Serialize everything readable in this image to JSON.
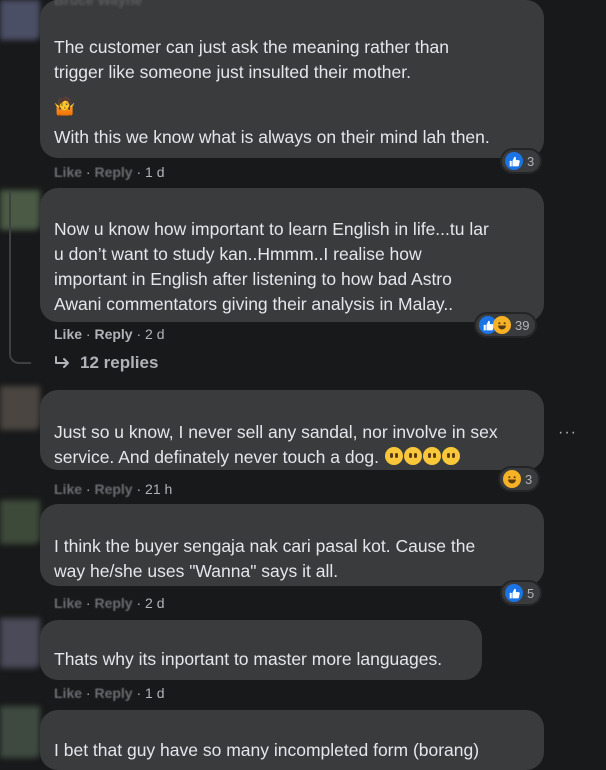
{
  "comments": [
    {
      "author": "Bruce Wayne",
      "lines": [
        "The customer can just ask the meaning rather than",
        "trigger like someone just insulted their mother."
      ],
      "emoji_line": "🤷",
      "lines2": [
        "With this we know what is always on their mind lah then."
      ],
      "actions": {
        "like": "Like",
        "reply": "Reply",
        "time": "1 d"
      },
      "reactions": {
        "count": "3"
      }
    },
    {
      "lines": [
        "Now u know how important to learn English in life...tu lar",
        "u don’t want to study kan..Hmmm..I realise how",
        "important in English after listening to how bad Astro",
        "Awani commentators giving their analysis in Malay.."
      ],
      "actions": {
        "like": "Like",
        "reply": "Reply",
        "time": "2 d"
      },
      "reactions": {
        "count": "39"
      }
    },
    {
      "lines": [
        "Just so u know, I never sell any sandal, nor involve in sex",
        "service. And definately never touch a dog."
      ],
      "actions": {
        "like": "Like",
        "reply": "Reply",
        "time": "21 h"
      },
      "reactions": {
        "count": "3"
      }
    },
    {
      "lines": [
        "I think the buyer sengaja nak cari pasal kot. Cause the",
        "way he/she uses \"Wanna\" says it all."
      ],
      "actions": {
        "like": "Like",
        "reply": "Reply",
        "time": "2 d"
      },
      "reactions": {
        "count": "5"
      }
    },
    {
      "lines": [
        "Thats why its inportant to master more languages."
      ],
      "actions": {
        "like": "Like",
        "reply": "Reply",
        "time": "1 d"
      }
    },
    {
      "lines": [
        "I bet that guy have so many incompleted form (borang)"
      ]
    }
  ],
  "thread": {
    "replies_label": "12 replies"
  },
  "more_label": "···",
  "separator": "·",
  "colors": {
    "background": "#18191a",
    "bubble": "#3a3b3c",
    "like_blue": "#1b74e4",
    "haha_yellow": "#f7b125"
  }
}
